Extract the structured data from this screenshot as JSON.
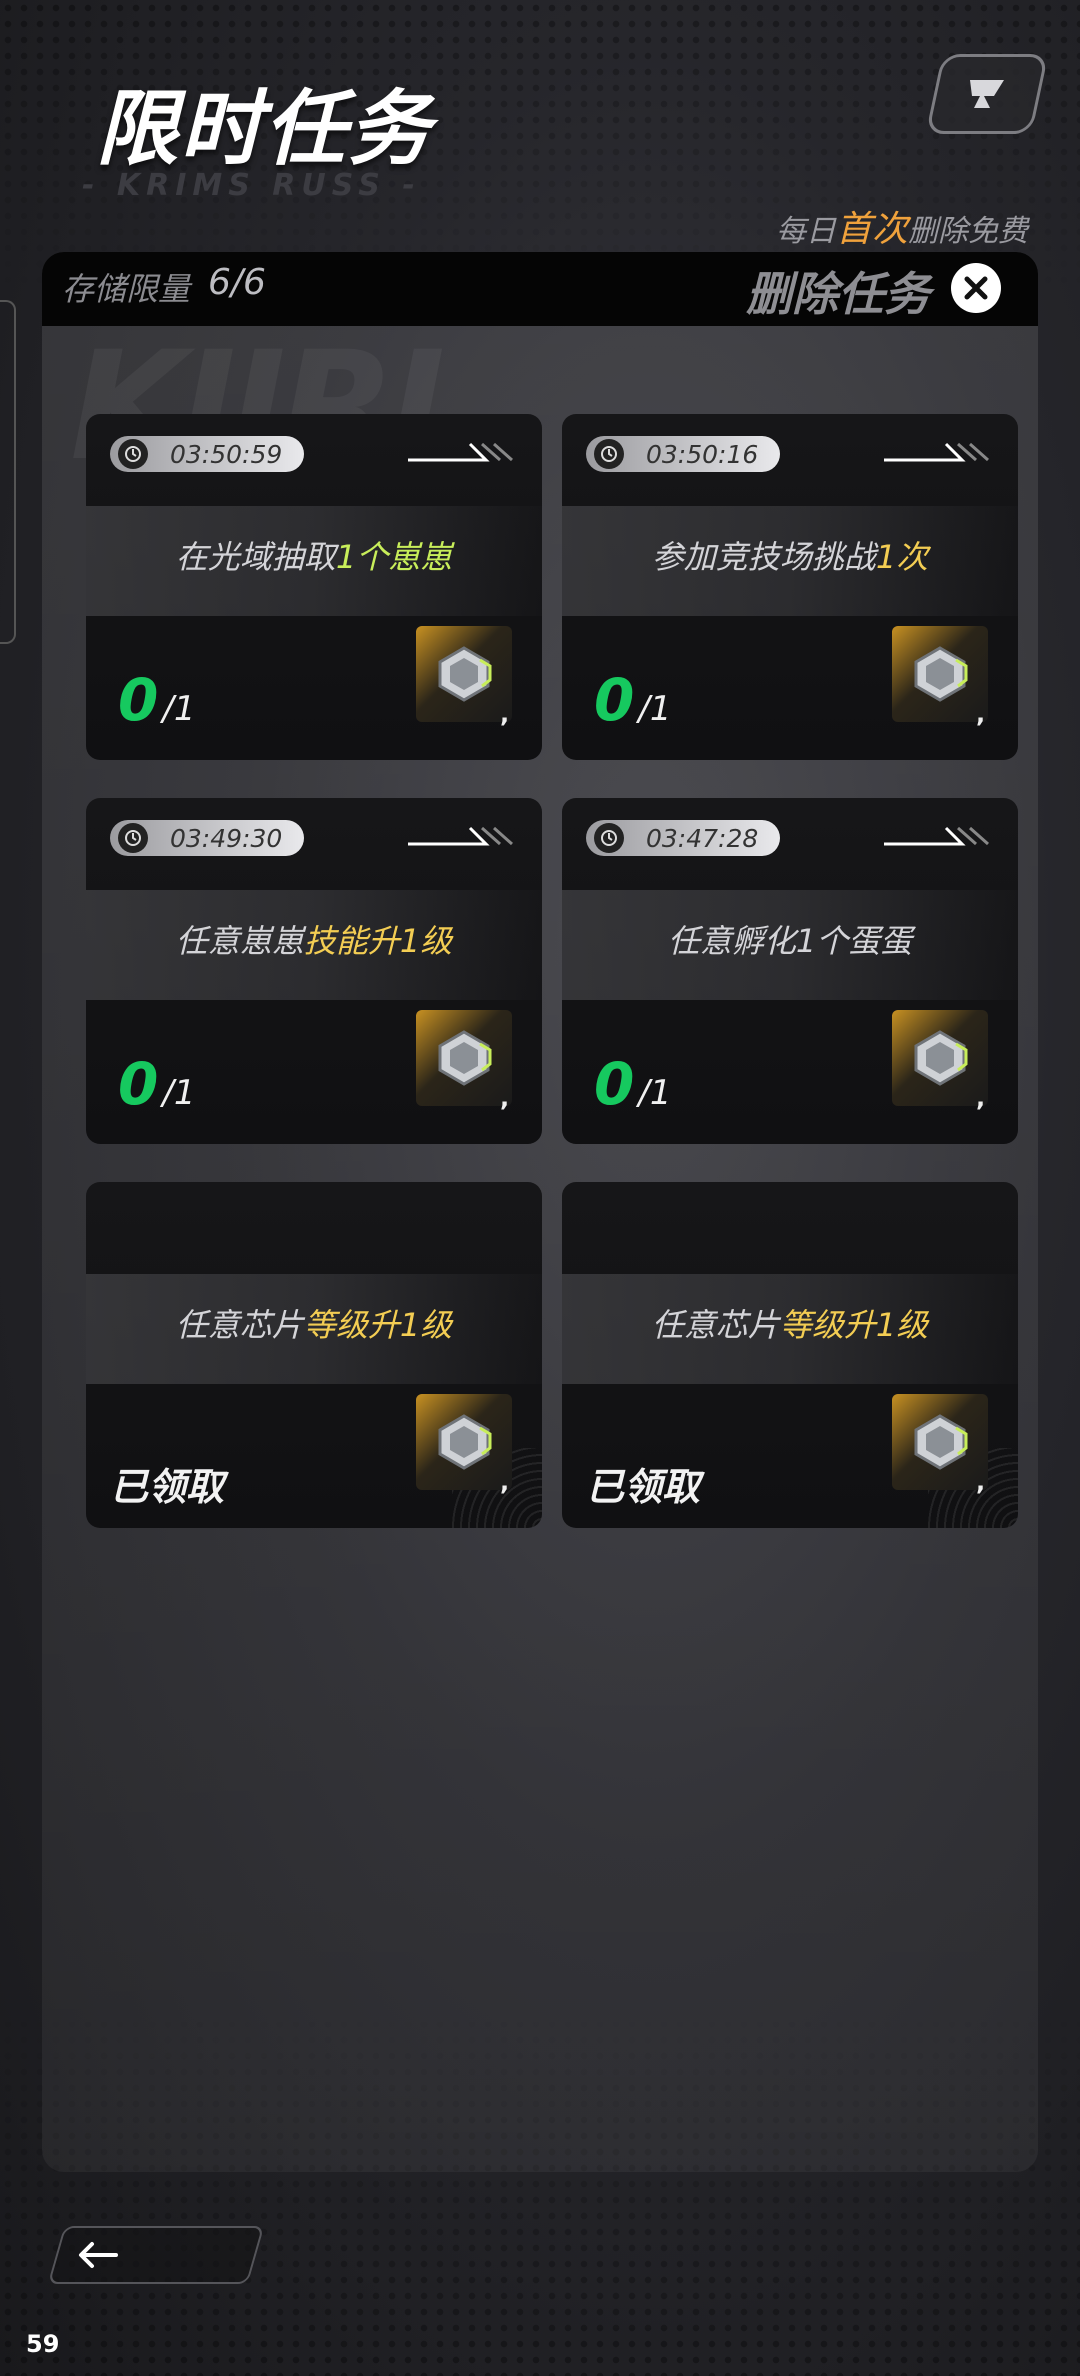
{
  "header": {
    "title": "限时任务",
    "subtitle_watermark": "- KRIMS RUSS -"
  },
  "delete_note": {
    "prefix": "每日",
    "highlight": "首次",
    "suffix": "删除免费"
  },
  "panel": {
    "storage_label": "存储限量",
    "storage_value": "6/6",
    "delete_label": "删除任务",
    "watermark": "KIIRI"
  },
  "cards": [
    {
      "timer": "03:50:59",
      "task_pre": "在光域抽取",
      "task_hl": "1个崽崽",
      "task_post": "",
      "hl_color": "green",
      "progress_current": "0",
      "progress_total": "/1",
      "reward_suffix": ","
    },
    {
      "timer": "03:50:16",
      "task_pre": "参加竞技场挑战",
      "task_hl": "1次",
      "task_post": "",
      "hl_color": "gold",
      "progress_current": "0",
      "progress_total": "/1",
      "reward_suffix": ","
    },
    {
      "timer": "03:49:30",
      "task_pre": "任意崽崽",
      "task_hl": "技能升1级",
      "task_post": "",
      "hl_color": "gold",
      "progress_current": "0",
      "progress_total": "/1",
      "reward_suffix": ","
    },
    {
      "timer": "03:47:28",
      "task_pre": "任意孵化1个蛋蛋",
      "task_hl": "",
      "task_post": "",
      "hl_color": "gold",
      "progress_current": "0",
      "progress_total": "/1",
      "reward_suffix": ","
    },
    {
      "task_pre": "任意芯片",
      "task_hl": "等级升1级",
      "task_post": "",
      "hl_color": "gold",
      "claimed_label": "已领取",
      "reward_suffix": ","
    },
    {
      "task_pre": "任意芯片",
      "task_hl": "等级升1级",
      "task_post": "",
      "hl_color": "gold",
      "claimed_label": "已领取",
      "reward_suffix": ","
    }
  ],
  "footer": {
    "back_icon": "back-arrow-icon",
    "fps": "59"
  },
  "colors": {
    "progress_green": "#16c95f",
    "highlight_gold": "#f3cd53",
    "highlight_green": "#c8ee5a",
    "note_orange": "#f0a23c"
  }
}
